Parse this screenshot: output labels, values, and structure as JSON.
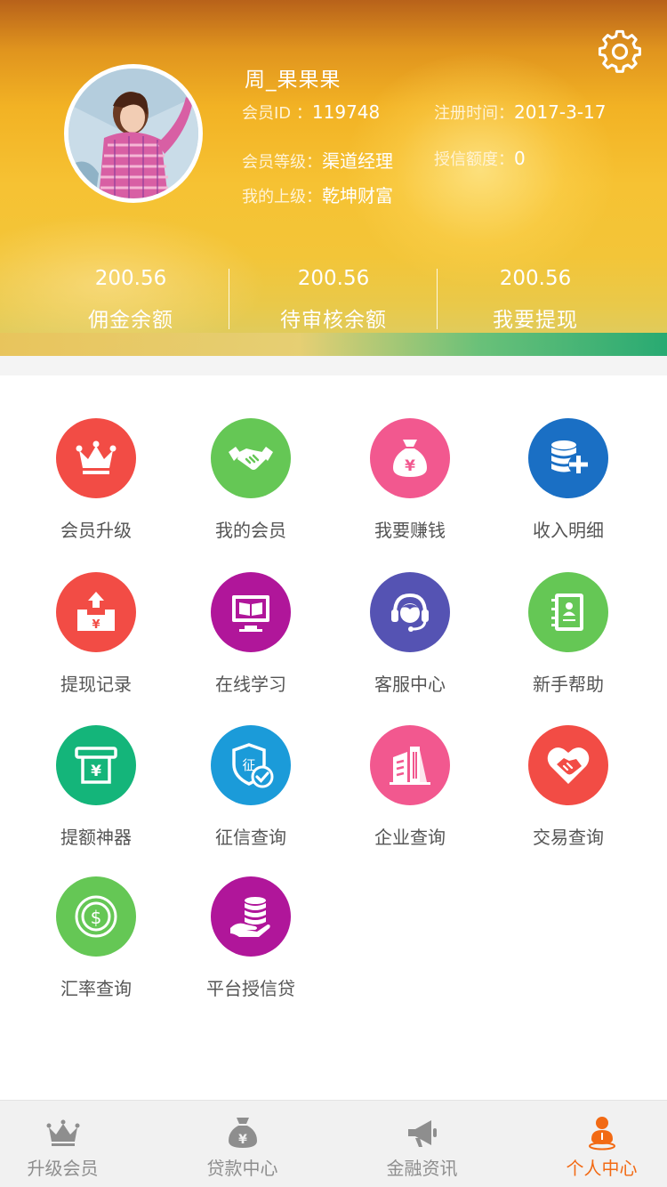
{
  "colors": {
    "accent": "#f26a14",
    "tab_inactive": "#8e8e8e",
    "label_gray": "#555555"
  },
  "header": {
    "settings_icon": "gear-icon",
    "user": {
      "name": "周_果果果",
      "member_id_label": "会员ID ：",
      "member_id": "119748",
      "register_label": "注册时间：",
      "register_date": "2017-3-17",
      "level_label": "会员等级：",
      "level": "渠道经理",
      "credit_label": "授信额度：",
      "credit": "0",
      "superior_label": "我的上级：",
      "superior": "乾坤财富"
    },
    "stats": [
      {
        "value": "200.56",
        "label": "佣金余额"
      },
      {
        "value": "200.56",
        "label": "待审核余额"
      },
      {
        "value": "200.56",
        "label": "我要提现"
      }
    ]
  },
  "menu": [
    {
      "label": "会员升级",
      "icon": "crown-icon",
      "color": "#f24c45"
    },
    {
      "label": "我的会员",
      "icon": "handshake-icon",
      "color": "#65c755"
    },
    {
      "label": "我要赚钱",
      "icon": "money-bag-icon",
      "color": "#f2588f"
    },
    {
      "label": "收入明细",
      "icon": "database-plus-icon",
      "color": "#1a6fc4"
    },
    {
      "label": "提现记录",
      "icon": "withdraw-box-icon",
      "color": "#f24c45"
    },
    {
      "label": "在线学习",
      "icon": "monitor-book-icon",
      "color": "#b0169a"
    },
    {
      "label": "客服中心",
      "icon": "headset-icon",
      "color": "#5553b3"
    },
    {
      "label": "新手帮助",
      "icon": "contact-book-icon",
      "color": "#65c755"
    },
    {
      "label": "提额神器",
      "icon": "atm-icon",
      "color": "#14b57a"
    },
    {
      "label": "征信查询",
      "icon": "shield-check-icon",
      "color": "#1b9bd9"
    },
    {
      "label": "企业查询",
      "icon": "building-icon",
      "color": "#f2588f"
    },
    {
      "label": "交易查询",
      "icon": "heart-handshake-icon",
      "color": "#f24c45"
    },
    {
      "label": "汇率查询",
      "icon": "dollar-coin-icon",
      "color": "#65c755"
    },
    {
      "label": "平台授信贷",
      "icon": "hand-coins-icon",
      "color": "#b0169a"
    }
  ],
  "tabbar": [
    {
      "label": "升级会员",
      "icon": "crown-icon",
      "active": false
    },
    {
      "label": "贷款中心",
      "icon": "money-bag-icon",
      "active": false
    },
    {
      "label": "金融资讯",
      "icon": "megaphone-icon",
      "active": false
    },
    {
      "label": "个人中心",
      "icon": "person-pin-icon",
      "active": true
    }
  ]
}
